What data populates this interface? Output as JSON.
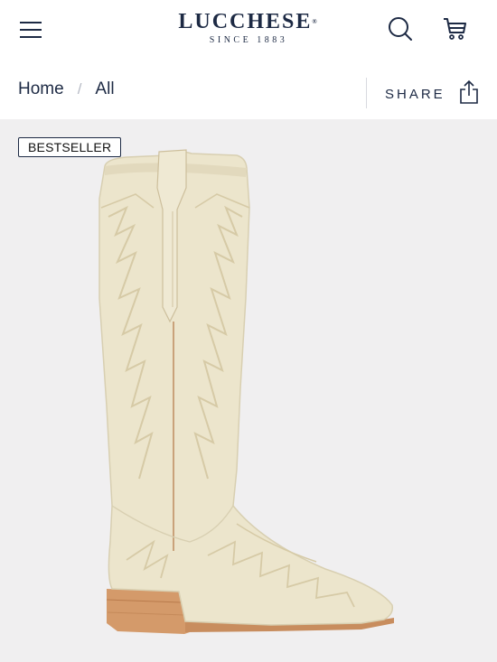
{
  "header": {
    "brand": "LUCCHESE",
    "brand_sub": "SINCE 1883",
    "menu_icon": "hamburger-menu-icon",
    "search_icon": "search-icon",
    "cart_icon": "shopping-cart-icon"
  },
  "breadcrumb": {
    "items": [
      "Home",
      "All"
    ],
    "separator": "/"
  },
  "share": {
    "label": "SHARE",
    "icon": "share-icon"
  },
  "product": {
    "badge": "BESTSELLER",
    "image": "tall-cream-cowboy-boot"
  },
  "colors": {
    "navy": "#1d2a44",
    "hero_bg": "#f0eff0",
    "boot_cream": "#ece5cc",
    "heel_wood": "#d49a6a"
  }
}
